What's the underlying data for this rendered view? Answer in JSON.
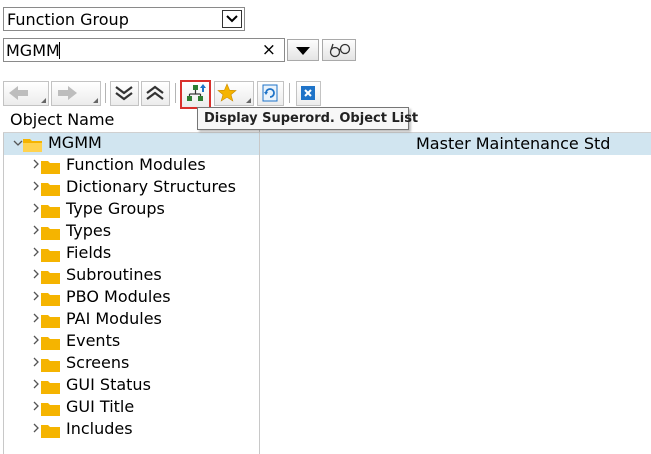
{
  "object_type": {
    "selected": "Function Group",
    "icon": "chevron-down-icon"
  },
  "object_name": {
    "value": "MGMM",
    "clear_glyph": "×"
  },
  "tooltip": {
    "text": "Display Superord. Object List"
  },
  "tree": {
    "header": "Object Name",
    "root": {
      "label": "MGMM",
      "description": "Master Maintenance Std"
    },
    "children": [
      {
        "label": "Function Modules"
      },
      {
        "label": "Dictionary Structures"
      },
      {
        "label": "Type Groups"
      },
      {
        "label": "Types"
      },
      {
        "label": "Fields"
      },
      {
        "label": "Subroutines"
      },
      {
        "label": "PBO Modules"
      },
      {
        "label": "PAI Modules"
      },
      {
        "label": "Events"
      },
      {
        "label": "Screens"
      },
      {
        "label": "GUI Status"
      },
      {
        "label": "GUI Title"
      },
      {
        "label": "Includes"
      }
    ]
  },
  "colors": {
    "folder": "#f5b400",
    "selection": "#d1e5f0",
    "highlight_border": "#d9302c",
    "close_blue": "#1e73c8"
  }
}
